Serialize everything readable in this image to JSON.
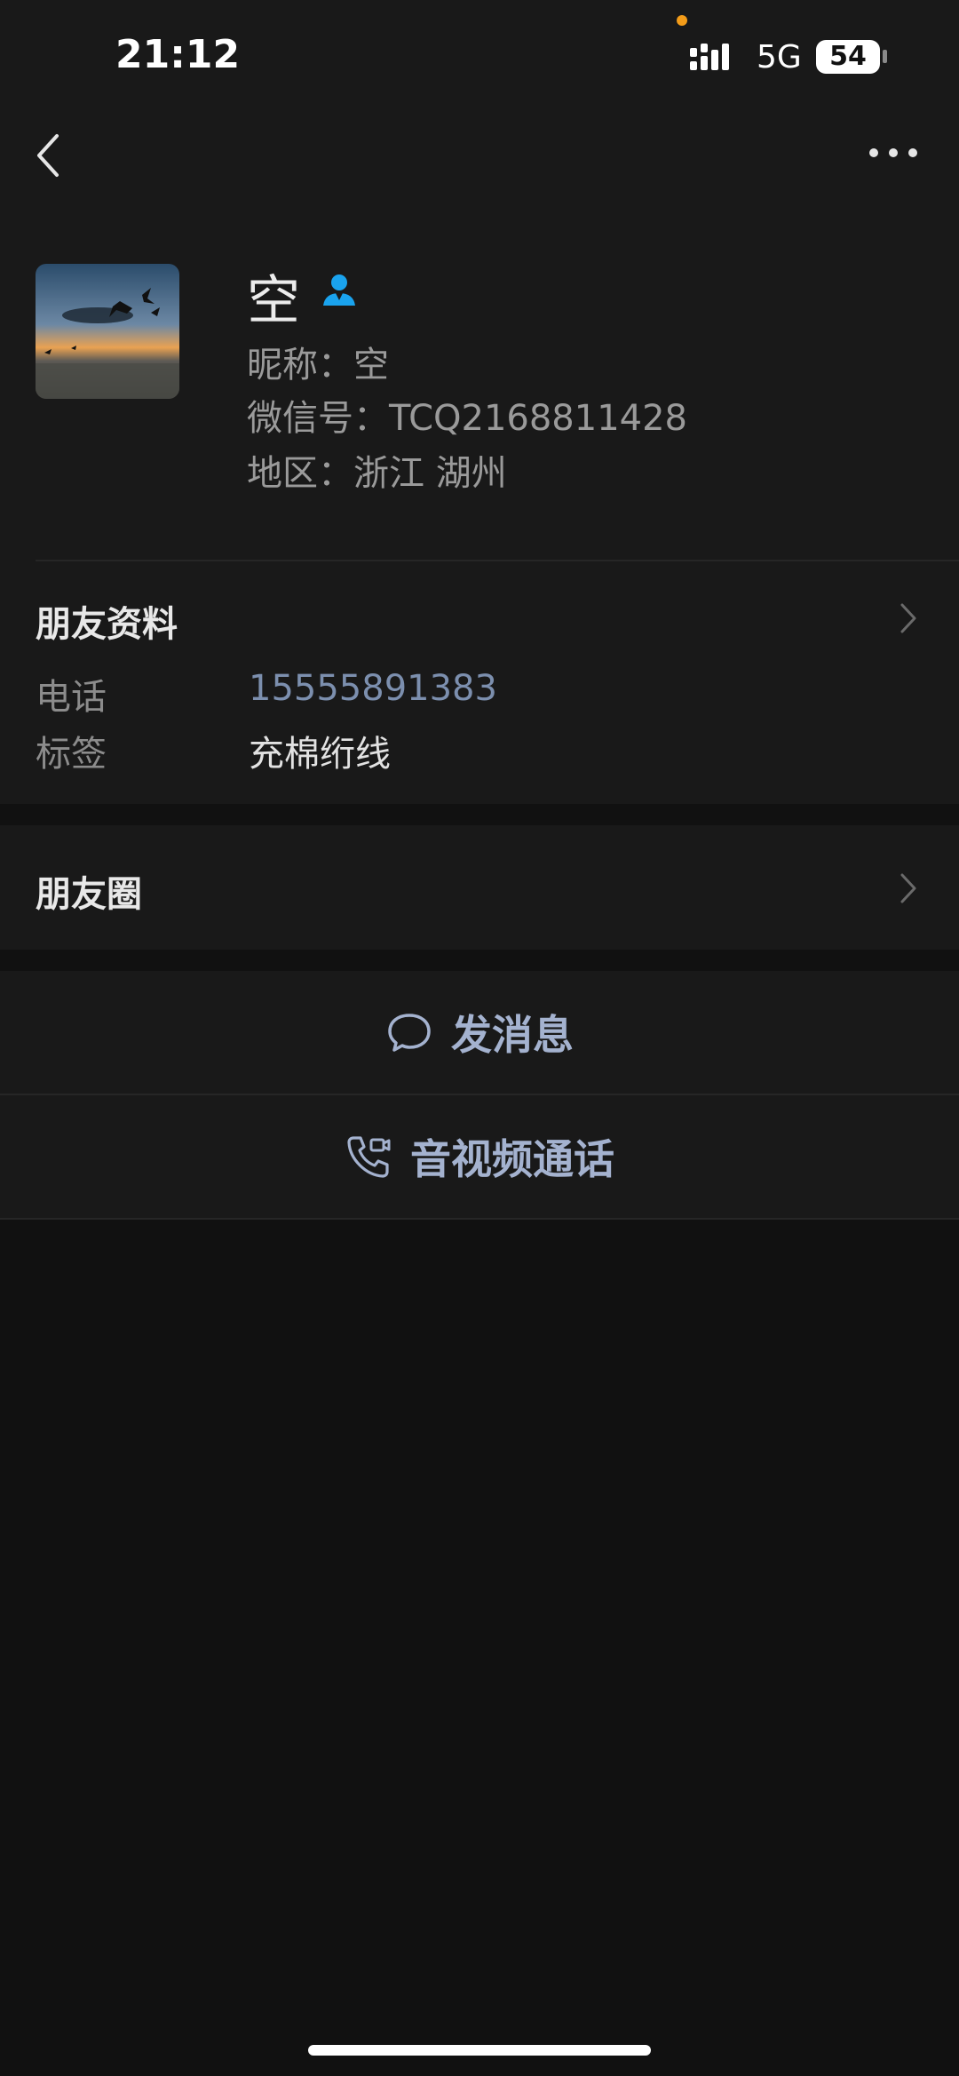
{
  "status_bar": {
    "time": "21:12",
    "network": "5G",
    "battery": "54",
    "dot_color": "#f39c19"
  },
  "header": {
    "back_icon": "chevron-left-icon",
    "more_icon": "more-dots-icon"
  },
  "profile": {
    "name": "空",
    "nickname": "昵称：空",
    "wechat_id": "微信号：TCQ2168811428",
    "region": "地区：浙江 湖州",
    "verify_icon": "person-badge-icon",
    "verify_color": "#1aa3ee"
  },
  "friend_info": {
    "title": "朋友资料",
    "phone_label": "电话",
    "phone_value": "15555891383",
    "tag_label": "标签",
    "tag_value": "充棉绗线"
  },
  "moments": {
    "title": "朋友圈"
  },
  "actions": {
    "message_label": "发消息",
    "message_icon": "chat-bubble-icon",
    "call_label": "音视频通话",
    "call_icon": "phone-video-icon",
    "accent": "#a4b2cf"
  }
}
